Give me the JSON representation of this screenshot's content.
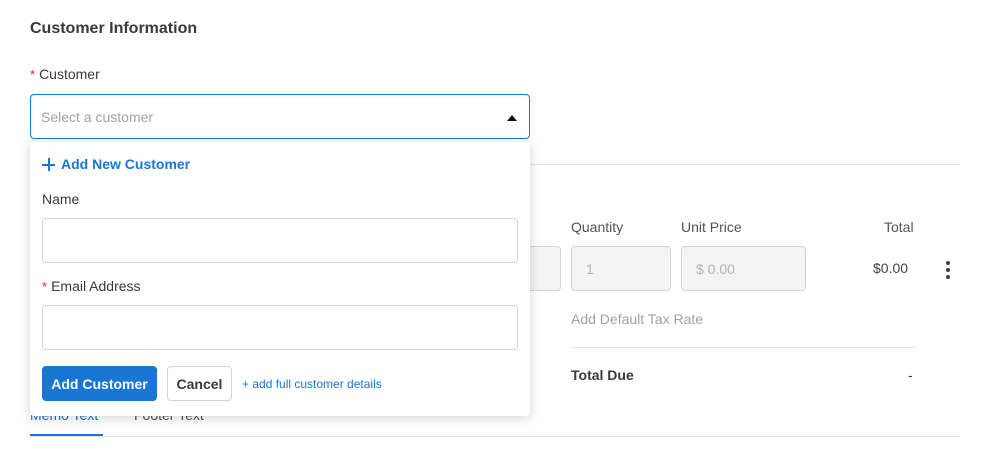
{
  "section": {
    "title": "Customer Information"
  },
  "customer_field": {
    "required_mark": "*",
    "label": "Customer",
    "placeholder": "Select a customer",
    "caret_icon": "caret-up-icon"
  },
  "dropdown": {
    "add_new": {
      "icon": "plus-icon",
      "label": "Add New Customer"
    },
    "name": {
      "label": "Name",
      "value": ""
    },
    "email": {
      "required_mark": "*",
      "label": "Email Address",
      "value": ""
    },
    "add_button": "Add Customer",
    "cancel_button": "Cancel",
    "full_details_link": "+ add full customer details"
  },
  "line_items": {
    "headers": {
      "quantity": "Quantity",
      "unit_price": "Unit Price",
      "total": "Total"
    },
    "row": {
      "quantity": "1",
      "unit_price": "$ 0.00",
      "total": "$0.00",
      "menu_icon": "more-vertical-icon"
    },
    "tax_link": "Add Default Tax Rate",
    "total_due_label": "Total Due",
    "total_due_value": "-"
  },
  "tabs": [
    {
      "label": "Memo Text",
      "active": true
    },
    {
      "label": "Footer Text",
      "active": false
    }
  ],
  "colors": {
    "accent": "#1976d2",
    "required": "#e0245e",
    "border": "#d4d4d8"
  }
}
